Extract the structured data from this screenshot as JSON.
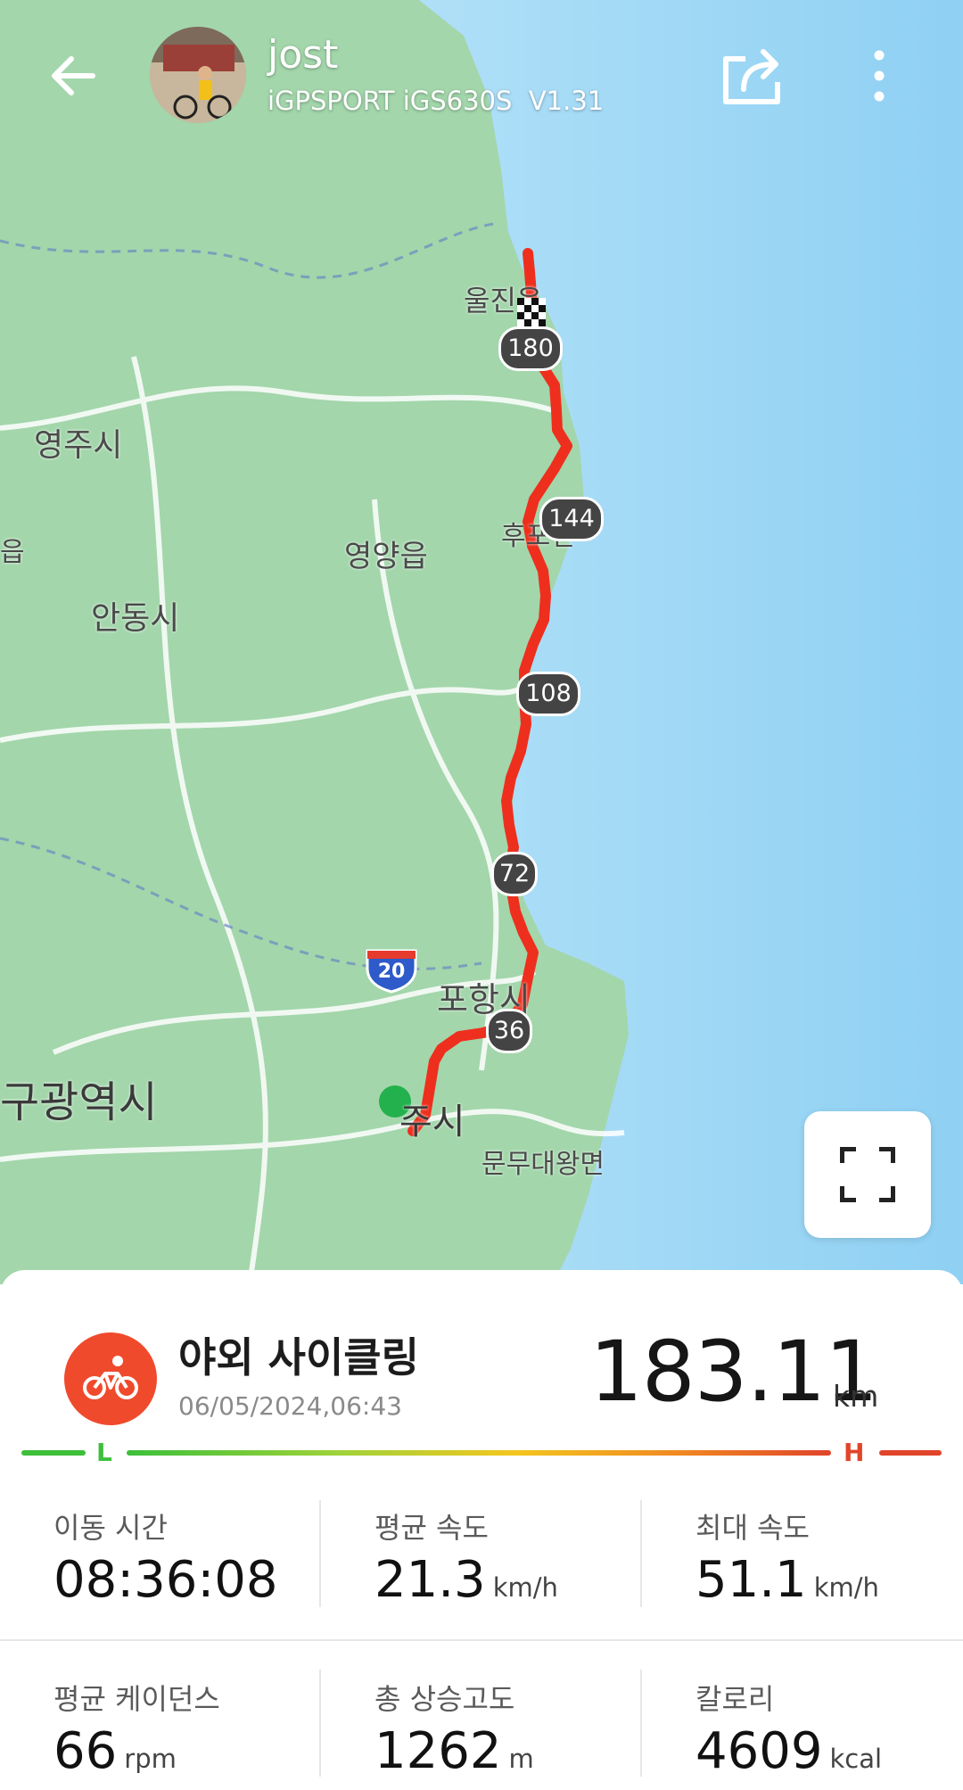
{
  "header": {
    "user_name": "jost",
    "device": "iGPSPORT iGS630S  V1.31",
    "icons": {
      "back": "arrow-left-icon",
      "share": "share-icon",
      "more": "more-vertical-icon"
    }
  },
  "map": {
    "place_labels": [
      "울진읍",
      "영주시",
      "영양읍",
      "후포면",
      "안동시",
      "포항시",
      "구광역시",
      "주시",
      "문무대왕면",
      "읍"
    ],
    "highway_shield": "20",
    "route_markers": [
      "180",
      "144",
      "108",
      "72",
      "36"
    ],
    "route_color": "#ee2f1e",
    "start_color": "#23b14d",
    "sea_color": "#a9dbf6",
    "land_color": "#9fd4a8",
    "icons": {
      "finish": "checkered-flag-icon",
      "fullscreen": "fullscreen-icon"
    }
  },
  "activity": {
    "sport_name": "야외 사이클링",
    "date": "06/05/2024,06:43",
    "distance": "183.11",
    "distance_unit": "km",
    "scale_low": "L",
    "scale_high": "H",
    "icon": "cycling-icon"
  },
  "stats": [
    {
      "label": "이동 시간",
      "value": "08:36:08",
      "unit": ""
    },
    {
      "label": "평균 속도",
      "value": "21.3",
      "unit": "km/h"
    },
    {
      "label": "최대 속도",
      "value": "51.1",
      "unit": "km/h"
    },
    {
      "label": "평균 케이던스",
      "value": "66",
      "unit": "rpm"
    },
    {
      "label": "총 상승고도",
      "value": "1262",
      "unit": "m"
    },
    {
      "label": "칼로리",
      "value": "4609",
      "unit": "kcal"
    }
  ]
}
